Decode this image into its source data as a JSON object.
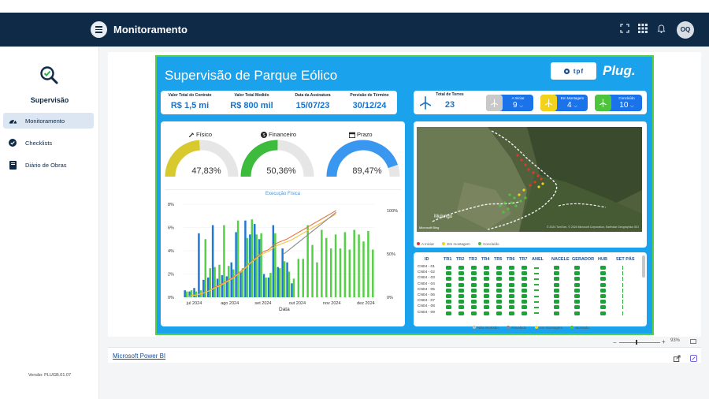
{
  "header": {
    "title": "Monitoramento",
    "avatar": "OQ",
    "icons": [
      "fullscreen-icon",
      "apps-grid-icon",
      "bell-icon"
    ]
  },
  "sidebar": {
    "title": "Supervisão",
    "items": [
      {
        "label": "Monitoramento",
        "icon": "speedometer-icon",
        "active": true
      },
      {
        "label": "Checklists",
        "icon": "check-circle-icon",
        "active": false
      },
      {
        "label": "Diário de Obras",
        "icon": "book-icon",
        "active": false
      }
    ],
    "version": "Versão: PLUGB.01.07"
  },
  "report": {
    "title": "Supervisão de Parque Eólico",
    "logo_text": "tpf",
    "brand": "Plug.",
    "kpis": [
      {
        "label": "Valor Total do Contrato",
        "value": "R$ 1,5 mi"
      },
      {
        "label": "Valor Total Medido",
        "value": "R$ 800 mil"
      },
      {
        "label": "Data da Assinatura",
        "value": "15/07/23"
      },
      {
        "label": "Previsão de Término",
        "value": "30/12/24"
      }
    ],
    "towers": {
      "total_label": "Total de Torres",
      "total": "23",
      "statuses": [
        {
          "label": "A Iniciar",
          "value": "9",
          "color": "#c9c9c9"
        },
        {
          "label": "Em Montagem",
          "value": "4",
          "color": "#f2d21b"
        },
        {
          "label": "Concluído",
          "value": "10",
          "color": "#4cc43c"
        }
      ]
    },
    "gauges": [
      {
        "title": "Físico",
        "value": "47,83%",
        "fraction": 0.4783,
        "color": "#d8c92e"
      },
      {
        "title": "Financeiro",
        "value": "50,36%",
        "fraction": 0.5036,
        "color": "#3dbb3d"
      },
      {
        "title": "Prazo",
        "value": "89,47%",
        "fraction": 0.8947,
        "color": "#3a97f0"
      }
    ],
    "map": {
      "label_city": "Mulungu",
      "attribution": "© 2024 TomTom, © 2024 Microsoft Corporation, Earthstar Geographics SIO",
      "bing_label": "Microsoft Bing",
      "legend": [
        {
          "label": "A Iniciar",
          "color": "#e0392b"
        },
        {
          "label": "Em montagem",
          "color": "#f2d21b"
        },
        {
          "label": "Concluído",
          "color": "#4cc43c"
        }
      ]
    },
    "table": {
      "headers": [
        "ID",
        "TR1",
        "TR2",
        "TR3",
        "TR4",
        "TR5",
        "TR6",
        "TR7",
        "ANEL",
        "NACELE",
        "GERADOR",
        "HUB",
        "SET PÁS"
      ],
      "rows": [
        "CN04 - 01",
        "CN04 - 02",
        "CN04 - 03",
        "CN04 - 04",
        "CN04 - 05",
        "CN04 - 06",
        "CN04 - 07",
        "CN04 - 08",
        "CN04 - 09"
      ],
      "legend": [
        {
          "label": "Não recebido",
          "color": "#bbbbbb"
        },
        {
          "label": "Recebido",
          "color": "#888888"
        },
        {
          "label": "Em montagem",
          "color": "#f2d21b"
        },
        {
          "label": "Montado",
          "color": "#4cc43c"
        }
      ]
    }
  },
  "chart_data": {
    "type": "bar",
    "title": "Execução Física",
    "xlabel": "Data",
    "ylabel": "",
    "x_tick_labels": [
      "jul 2024",
      "ago 2024",
      "set 2024",
      "out 2024",
      "nov 2024",
      "dez 2024"
    ],
    "y_left_ticks": [
      "0%",
      "2%",
      "4%",
      "6%",
      "8%"
    ],
    "y_right_ticks": [
      "0%",
      "50%",
      "100%"
    ],
    "ylim": [
      0,
      8
    ],
    "series": [
      {
        "values": [
          0.6,
          0.5,
          0.8,
          5.5,
          1.5,
          1.7,
          6.2,
          1.6,
          1.9,
          1.8,
          3.0,
          5.6,
          2.2,
          6.6,
          5.4,
          6.3,
          5.0,
          2.0,
          1.7,
          6.2,
          2.6,
          4.2,
          3.0,
          1.2,
          0,
          0,
          0,
          0,
          0,
          0,
          0,
          0,
          0,
          0,
          0,
          0,
          0,
          0,
          0,
          0,
          0
        ]
      },
      {
        "values": [
          0.5,
          0.6,
          0.5,
          0.6,
          5.0,
          2.5,
          2.6,
          2.8,
          6.2,
          2.7,
          2.4,
          6.6,
          2.5,
          5.1,
          6.7,
          5.4,
          5.5,
          1.7,
          2.1,
          5.5,
          2.5,
          3.1,
          2.2,
          1.6,
          3.3,
          3.3,
          6.2,
          4.5,
          3.0,
          5.8,
          5.1,
          4.2,
          5.4,
          4.2,
          5.6,
          4.1,
          5.8,
          5.4,
          4.8,
          5.7,
          4.1
        ]
      }
    ],
    "cumulative_lines": [
      {
        "color": "#e8743b",
        "values": [
          1,
          2,
          3,
          4,
          6,
          8,
          12,
          14,
          17,
          20,
          23,
          27,
          31,
          36,
          41,
          45,
          50,
          53,
          55,
          60,
          63,
          65,
          67,
          70,
          73,
          76,
          79,
          82,
          85,
          88,
          91,
          94,
          97,
          100
        ]
      },
      {
        "color": "#f4c542",
        "values": [
          1,
          2,
          3,
          4,
          6,
          8,
          11,
          13,
          16,
          19,
          22,
          26,
          30,
          35,
          40,
          44,
          48,
          51,
          53,
          57,
          60,
          62,
          64,
          66,
          69,
          72,
          75,
          78,
          81,
          84,
          87,
          90,
          93,
          96
        ]
      },
      {
        "color": "#8a8a8a",
        "values": [
          null,
          null,
          null,
          null,
          null,
          null,
          null,
          null,
          null,
          null,
          null,
          null,
          null,
          null,
          null,
          null,
          null,
          null,
          null,
          null,
          null,
          null,
          50,
          54,
          58,
          62,
          66,
          70,
          74,
          78,
          82,
          86,
          90,
          94,
          98
        ]
      }
    ]
  },
  "footer": {
    "powerbi": "Microsoft Power BI",
    "zoom": "93%"
  }
}
